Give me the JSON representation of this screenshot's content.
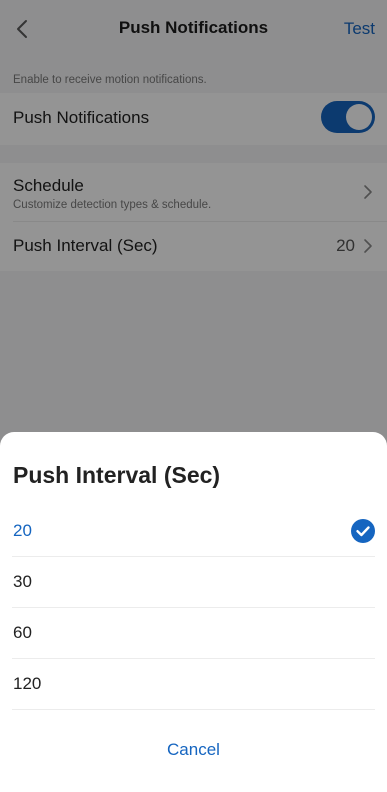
{
  "header": {
    "back_icon": "chevron-left-icon",
    "title": "Push Notifications",
    "test_label": "Test"
  },
  "settings": {
    "caption": "Enable to receive motion notifications.",
    "push_notifications": {
      "label": "Push Notifications",
      "enabled": true
    },
    "schedule": {
      "label": "Schedule",
      "sublabel": "Customize detection types & schedule."
    },
    "push_interval": {
      "label": "Push Interval (Sec)",
      "value": "20"
    }
  },
  "sheet": {
    "title": "Push Interval (Sec)",
    "options": [
      "20",
      "30",
      "60",
      "120"
    ],
    "selected": "20",
    "cancel_label": "Cancel"
  },
  "colors": {
    "accent": "#1565c0",
    "background": "#f4f4f6",
    "overlay": "rgba(0,0,0,0.42)"
  }
}
